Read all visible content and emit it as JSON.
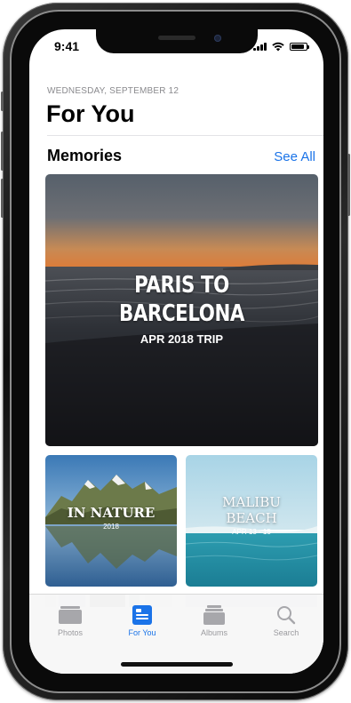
{
  "status": {
    "time": "9:41"
  },
  "header": {
    "date": "WEDNESDAY, SEPTEMBER 12",
    "title": "For You"
  },
  "memories": {
    "section_title": "Memories",
    "see_all": "See All",
    "featured": {
      "line1": "PARIS TO",
      "line2": "BARCELONA",
      "subtitle": "APR 2018 TRIP"
    },
    "cards": [
      {
        "title": "IN NATURE",
        "subtitle": "2018"
      },
      {
        "title_line1": "MALIBU",
        "title_line2": "BEACH",
        "subtitle": "APR 13 - 15"
      }
    ]
  },
  "tabs": [
    {
      "label": "Photos",
      "icon": "photos-icon"
    },
    {
      "label": "For You",
      "icon": "for-you-icon"
    },
    {
      "label": "Albums",
      "icon": "albums-icon"
    },
    {
      "label": "Search",
      "icon": "search-icon"
    }
  ],
  "colors": {
    "accent": "#1a73e8",
    "inactive": "#9a9a9e"
  }
}
